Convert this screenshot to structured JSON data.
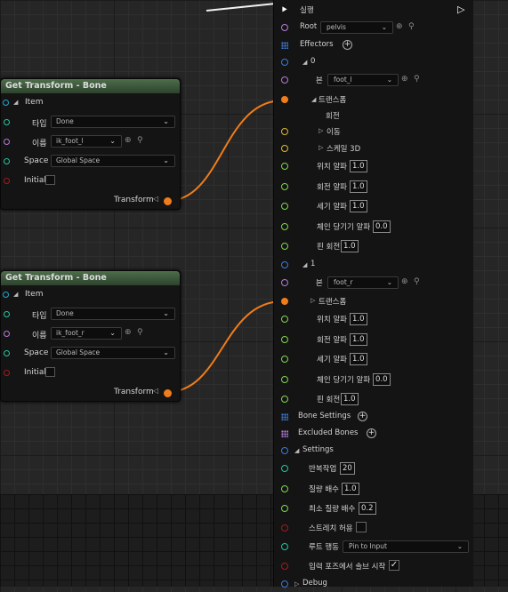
{
  "colors": {
    "exec": "#ffffff",
    "struct": "#1ea7d6",
    "name": "#b67bd9",
    "transform": "#f07d1a",
    "float": "#7cd84e",
    "bool": "#a21b1b",
    "int": "#24c49d",
    "vector": "#e2b82d",
    "bone": "#3d7bd9"
  },
  "nodes": [
    {
      "title": "Get Transform - Bone",
      "item_label": "Item",
      "type_label": "타입",
      "type_value": "Done",
      "name_label": "이름",
      "name_value": "ik_foot_l",
      "space_label": "Space",
      "space_value": "Global Space",
      "initial_label": "Initial",
      "out_label": "Transform"
    },
    {
      "title": "Get Transform - Bone",
      "item_label": "Item",
      "type_label": "타입",
      "type_value": "Done",
      "name_label": "이름",
      "name_value": "ik_foot_r",
      "space_label": "Space",
      "space_value": "Global Space",
      "initial_label": "Initial",
      "out_label": "Transform"
    }
  ],
  "panel": {
    "exec_label": "실행",
    "root_label": "Root",
    "root_value": "pelvis",
    "effectors_label": "Effectors",
    "e0": {
      "index": "0",
      "bone_label": "본",
      "bone_value": "foot_l",
      "transform_label": "트랜스폼",
      "rotation_label": "회전",
      "translation_label": "이동",
      "scale_label": "스케일 3D",
      "pos_alpha_label": "위치 알파",
      "pos_alpha": "1.0",
      "rot_alpha_label": "회전 알파",
      "rot_alpha": "1.0",
      "strength_alpha_label": "세기 알파",
      "strength_alpha": "1.0",
      "pull_alpha_label": "체인 당기기 알파",
      "pull_alpha": "0.0",
      "pin_rot_label": "핀 회전",
      "pin_rot": "1.0"
    },
    "e1": {
      "index": "1",
      "bone_label": "본",
      "bone_value": "foot_r",
      "transform_label": "트랜스폼",
      "pos_alpha_label": "위치 알파",
      "pos_alpha": "1.0",
      "rot_alpha_label": "회전 알파",
      "rot_alpha": "1.0",
      "strength_alpha_label": "세기 알파",
      "strength_alpha": "1.0",
      "pull_alpha_label": "체인 당기기 알파",
      "pull_alpha": "0.0",
      "pin_rot_label": "핀 회전",
      "pin_rot": "1.0"
    },
    "bone_settings_label": "Bone Settings",
    "excluded_bones_label": "Excluded Bones",
    "settings_label": "Settings",
    "iterations_label": "반복작업",
    "iterations": "20",
    "mass_label": "질량 배수",
    "mass": "1.0",
    "min_mass_label": "최소 질량 배수",
    "min_mass": "0.2",
    "stretch_label": "스트레치 허용",
    "root_behavior_label": "루트 행동",
    "root_behavior_value": "Pin to Input",
    "start_from_input_label": "입력 포즈에서 솔브 시작",
    "debug_label": "Debug"
  }
}
